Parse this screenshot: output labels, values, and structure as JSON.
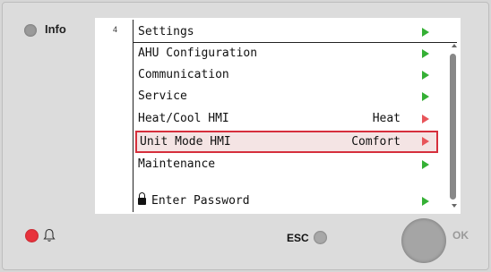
{
  "info": {
    "label": "Info"
  },
  "screen": {
    "level": "4",
    "title": "Settings",
    "items": [
      {
        "label": "AHU Configuration",
        "value": ""
      },
      {
        "label": "Communication",
        "value": ""
      },
      {
        "label": "Service",
        "value": ""
      },
      {
        "label": "Heat/Cool HMI",
        "value": "Heat"
      },
      {
        "label": "Unit Mode HMI",
        "value": "Comfort"
      },
      {
        "label": "Maintenance",
        "value": ""
      },
      {
        "label": "Enter Password",
        "value": ""
      }
    ]
  },
  "controls": {
    "esc_label": "ESC",
    "ok_label": "OK"
  },
  "colors": {
    "accent_green": "#35b035",
    "selection_red": "#d62f3c",
    "alarm_led": "#e8323c"
  },
  "icons": {
    "info_led": "led-icon",
    "alarm_led": "alarm-led-icon",
    "bell": "bell-icon",
    "lock": "lock-icon"
  }
}
